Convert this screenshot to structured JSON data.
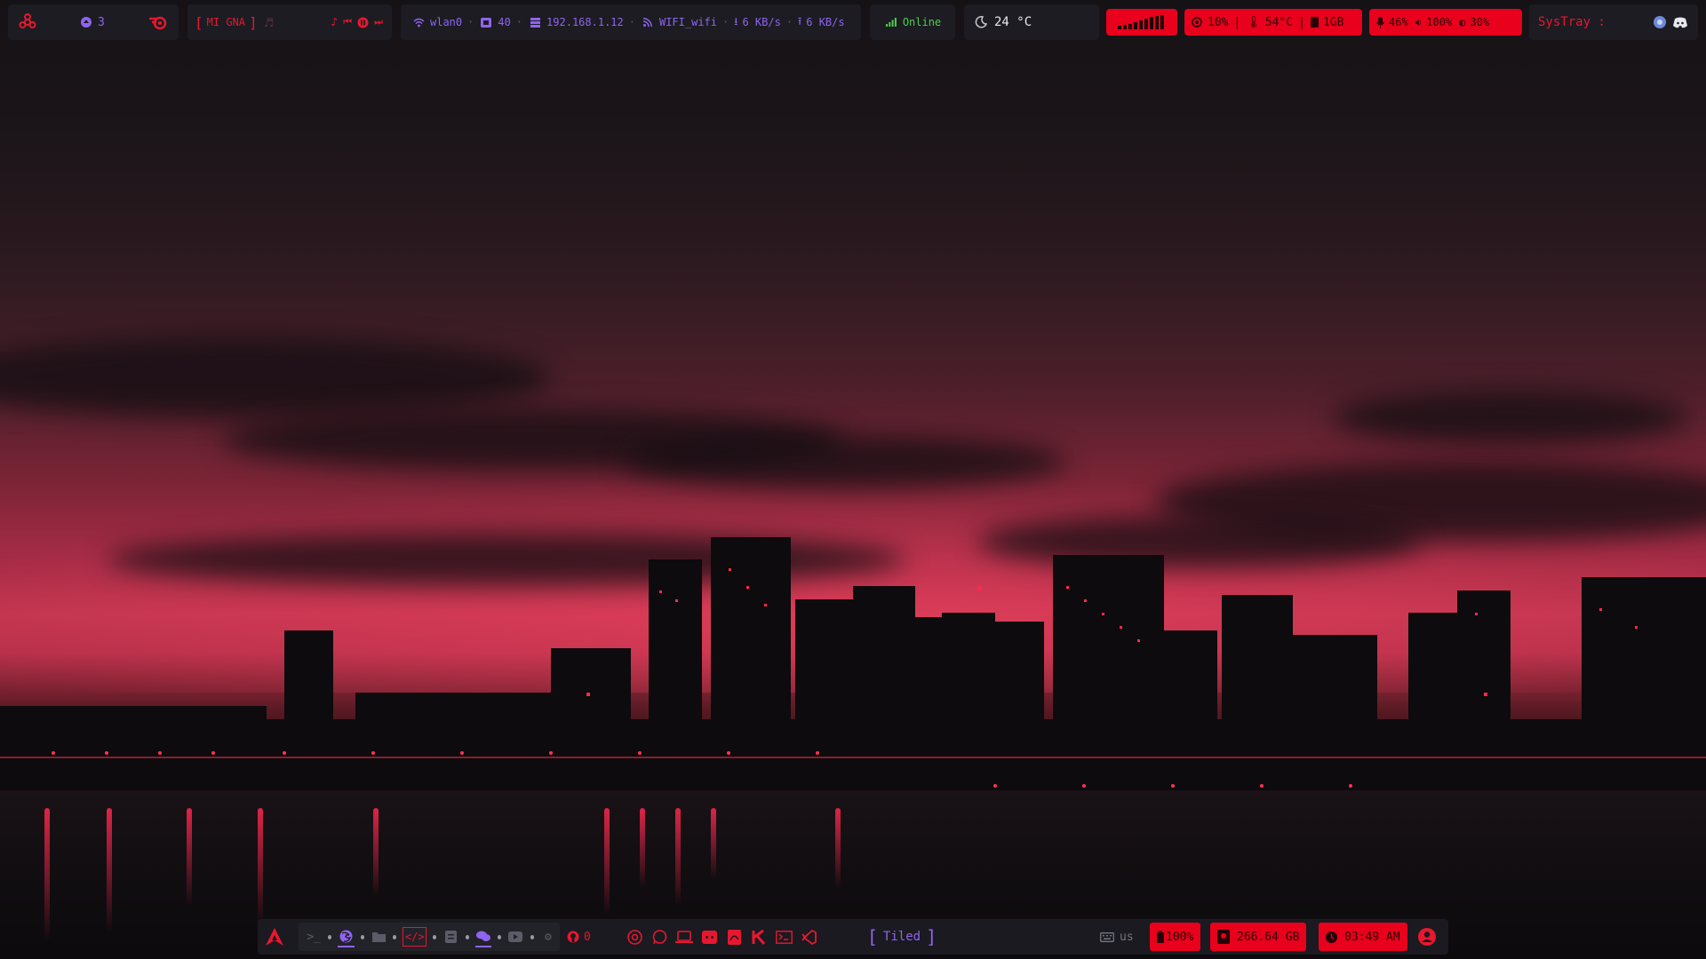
{
  "colors": {
    "accent": "#8f64f0",
    "alert": "#e8001c",
    "online": "#4bd04b",
    "bar_bg": "#1c1c22"
  },
  "topbar": {
    "left": {
      "logo_icon": "biohazard-icon",
      "notifications_count": "3",
      "updates_icon": "blender-icon"
    },
    "music": {
      "now_playing": "MI GNA",
      "note_icon": "music-note-icon",
      "controls": [
        "previous-icon",
        "pause-icon",
        "next-icon"
      ]
    },
    "network": {
      "interface": "wlan0",
      "signal": "40",
      "ip": "192.168.1.12",
      "ssid": "WIFI_wifi",
      "down": "6 KB/s",
      "up": "6 KB/s"
    },
    "status": "Online",
    "weather": "24 °C",
    "cpu_bars_icon": "cpu-graph-icon",
    "system": {
      "cpu": "10%",
      "temp": "54°C",
      "memory": "1GB"
    },
    "audio": {
      "mic": "46%",
      "volume": "100%",
      "brightness": "30%"
    },
    "systray": {
      "label": "SysTray :",
      "icons": [
        "network-manager-icon",
        "discord-icon"
      ]
    }
  },
  "bottombar": {
    "launcher_icon": "arch-logo-icon",
    "workspaces": [
      "terminal-icon",
      "firefox-icon",
      "folder-icon",
      "code-icon",
      "notes-icon",
      "chat-icon",
      "youtube-icon",
      "settings-icon"
    ],
    "github_count": "0",
    "apps": [
      "chrome-icon",
      "whatsapp-icon",
      "laptop-icon",
      "discord-icon",
      "pdf-icon",
      "kdenlive-icon",
      "terminal-icon",
      "vscode-icon"
    ],
    "layout": "Tiled",
    "keyboard": "us",
    "battery": "100%",
    "disk": "266.64 GB",
    "clock": "03:49 AM",
    "power_icon": "user-power-icon"
  }
}
